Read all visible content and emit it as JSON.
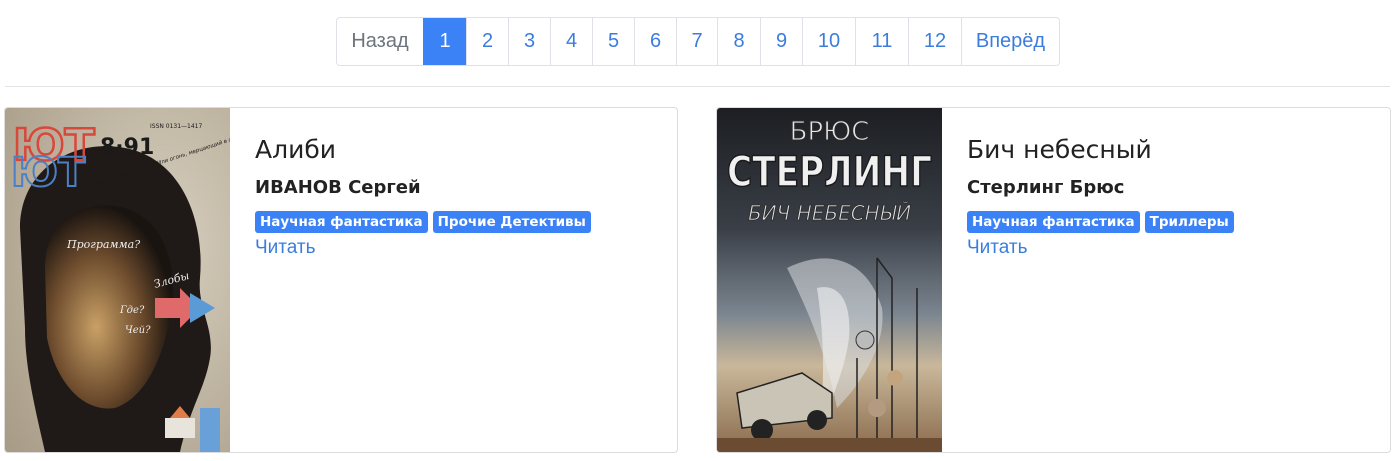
{
  "pagination": {
    "prev_label": "Назад",
    "pages": [
      "1",
      "2",
      "3",
      "4",
      "5",
      "6",
      "7",
      "8",
      "9",
      "10",
      "11",
      "12"
    ],
    "active_page": "1",
    "next_label": "Вперёд"
  },
  "books": [
    {
      "title": "Алиби",
      "author": "ИВАНОВ Сергей",
      "tags": [
        "Научная фантастика",
        "Прочие Детективы"
      ],
      "read_label": "Читать",
      "cover": {
        "magazine_logo": "ЮТ",
        "issue": "8·91",
        "issn": "ISSN 0131—1417",
        "tagline": "„Сосуд, в котором пусто, Или огонь, мерцающий в сосуде?“",
        "handwriting": [
          "Программа?",
          "Злобы",
          "Где?",
          "Чей?"
        ]
      }
    },
    {
      "title": "Бич небесный",
      "author": "Стерлинг Брюс",
      "tags": [
        "Научная фантастика",
        "Триллеры"
      ],
      "read_label": "Читать",
      "cover": {
        "author_first": "БРЮС",
        "author_last": "СТЕРЛИНГ",
        "title": "БИЧ НЕБЕСНЫЙ"
      }
    }
  ],
  "colors": {
    "accent": "#3b82f6",
    "link": "#3b7ddd",
    "border": "#dee2e6"
  }
}
